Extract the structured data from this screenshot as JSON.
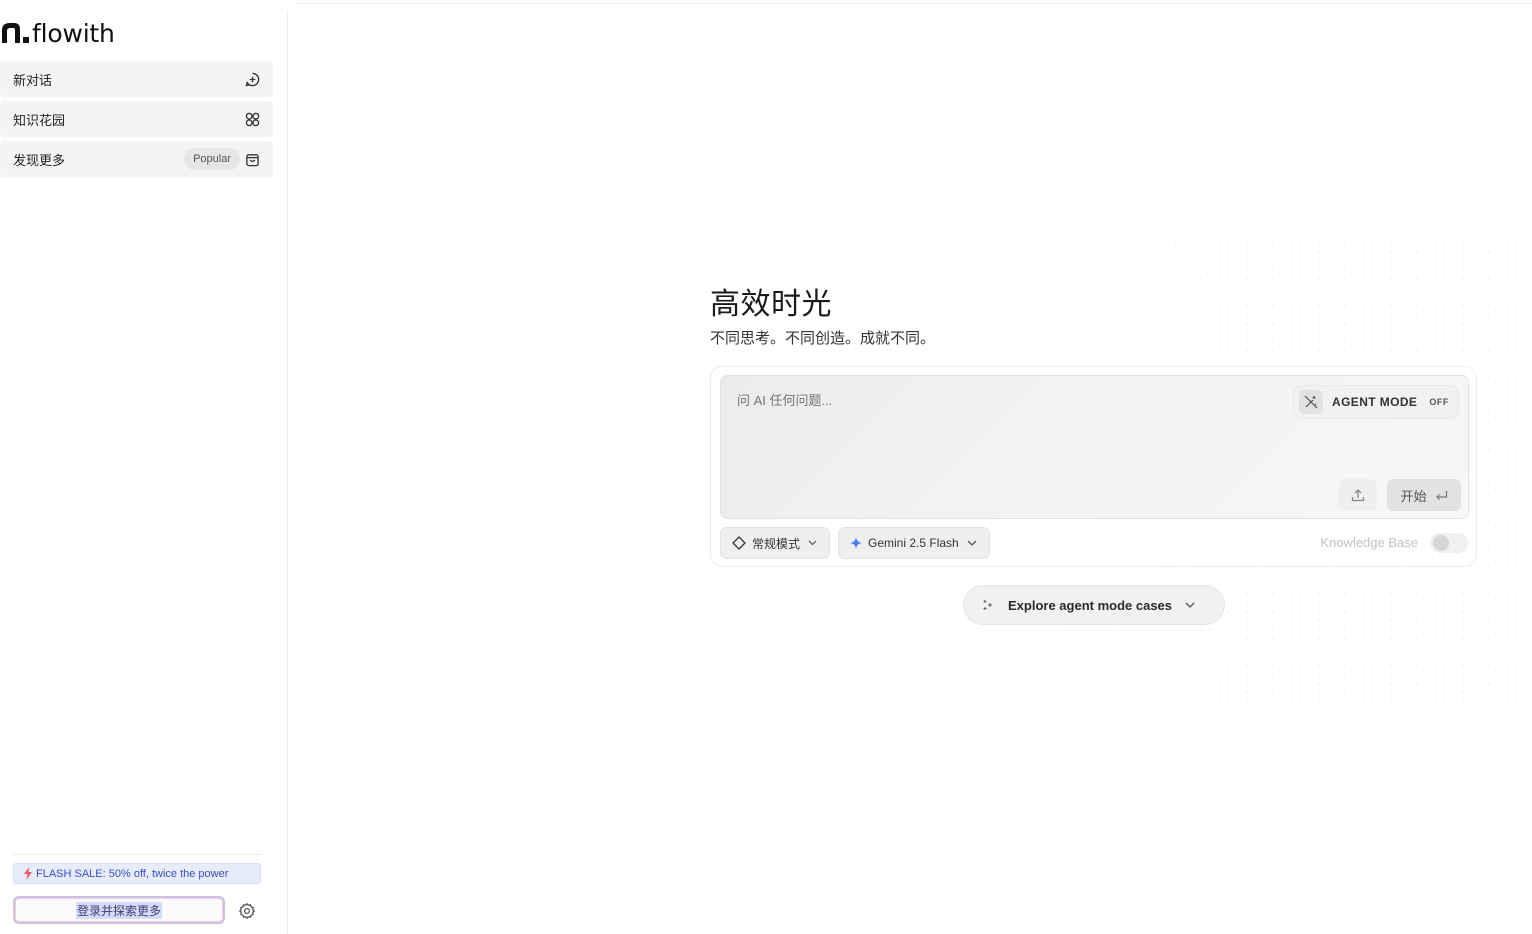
{
  "brand": {
    "name": "flowith",
    "icon": "flowith-logo-icon"
  },
  "sidebar": {
    "items": [
      {
        "label": "新对话",
        "icon": "new-chat-icon"
      },
      {
        "label": "知识花园",
        "icon": "knowledge-garden-icon"
      },
      {
        "label": "发现更多",
        "badge": "Popular",
        "icon": "discover-bag-icon"
      }
    ],
    "flash_sale": "FLASH SALE: 50% off, twice the power",
    "login_label": "登录并探索更多",
    "settings_icon": "gear-icon"
  },
  "hero": {
    "title": "高效时光",
    "subtitle": "不同思考。不同创造。成就不同。"
  },
  "composer": {
    "placeholder": "问 AI 任何问题...",
    "agent_mode_label": "AGENT MODE",
    "agent_mode_state": "OFF",
    "start_label": "开始",
    "mode_label": "常规模式",
    "model_label": "Gemini 2.5 Flash",
    "knowledge_base_label": "Knowledge Base",
    "knowledge_base_enabled": false
  },
  "explore": {
    "label": "Explore agent mode cases"
  },
  "colors": {
    "flash_bg": "#e7ecfb",
    "flash_text": "#3b4fc5",
    "gemini_accent": "#4a7df0"
  }
}
